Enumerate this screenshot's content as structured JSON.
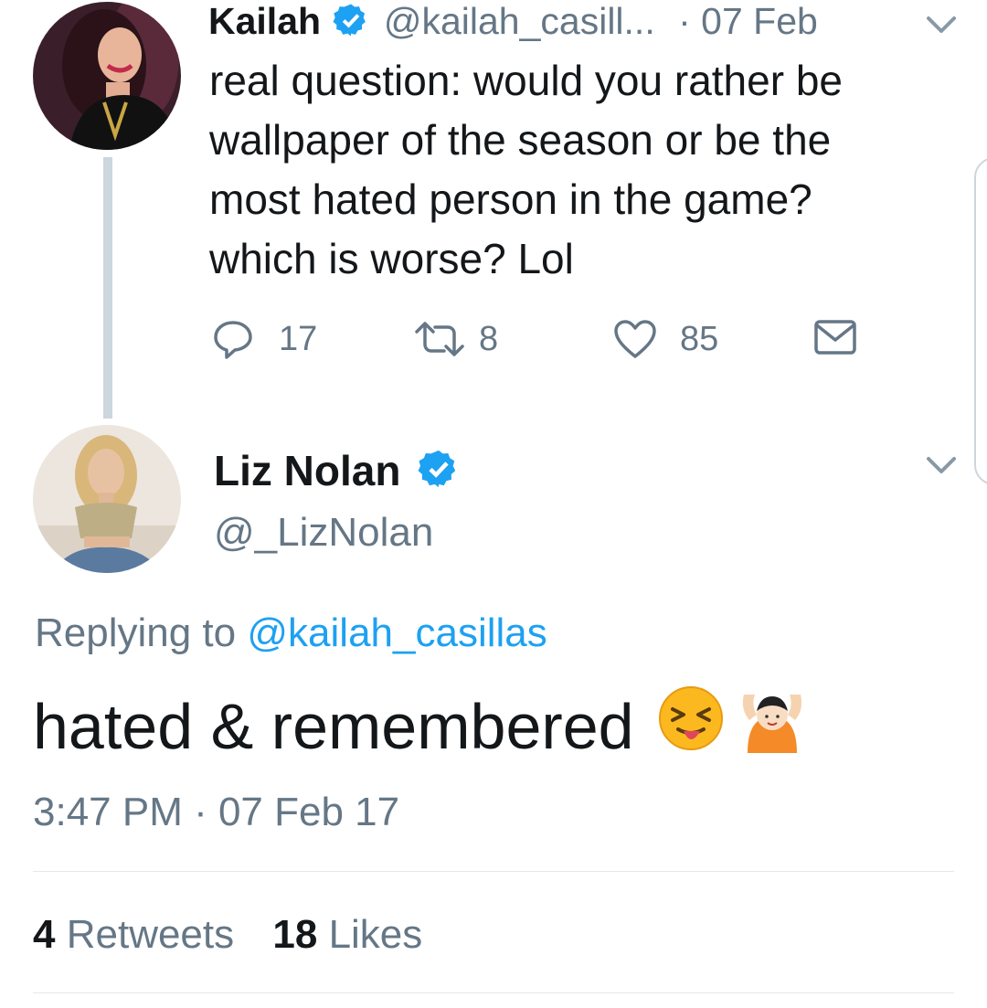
{
  "colors": {
    "accent": "#1da1f2",
    "muted": "#657786",
    "text": "#14171a",
    "line": "#ccd6dd"
  },
  "parent_tweet": {
    "author_name": "Kailah",
    "author_handle": "@kailah_casill...",
    "date": "· 07 Feb",
    "verified_icon": "verified-badge-icon",
    "text_lines": [
      "real question: would you rather be",
      "wallpaper of the season or be the",
      "most hated person in the game?",
      "which is worse? Lol"
    ],
    "actions": {
      "reply_count": "17",
      "retweet_count": "8",
      "like_count": "85"
    },
    "icons": [
      "reply-icon",
      "retweet-icon",
      "like-icon",
      "direct-message-icon",
      "chevron-down-icon"
    ]
  },
  "main_tweet": {
    "author_name": "Liz Nolan",
    "author_handle": "@_LizNolan",
    "replying_to_prefix": "Replying to",
    "replying_to_handle": "@kailah_casillas",
    "text": "hated & remembered",
    "emojis": [
      "squinting-tongue-emoji",
      "person-raising-hands-emoji"
    ],
    "timestamp": "3:47 PM · 07 Feb 17",
    "stats": {
      "retweets_count": "4",
      "retweets_label": "Retweets",
      "likes_count": "18",
      "likes_label": "Likes"
    }
  }
}
